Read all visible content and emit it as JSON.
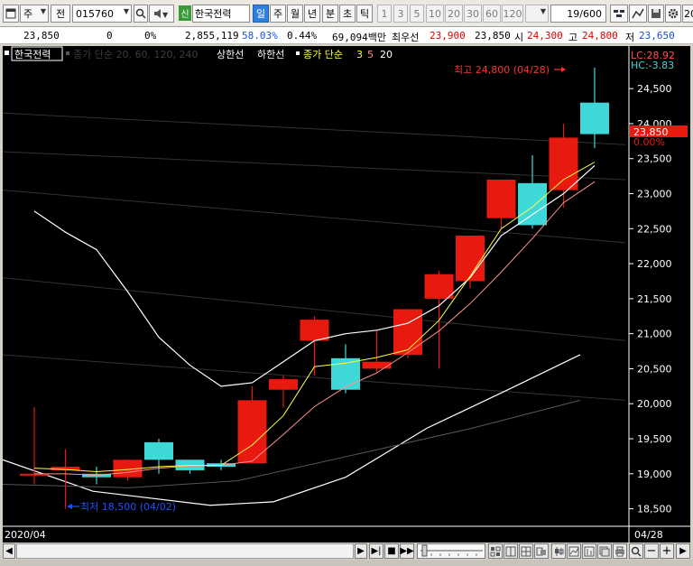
{
  "toolbar": {
    "market": "주",
    "type": "전",
    "code": "015760",
    "badge": "신",
    "name": "한국전력",
    "periods": [
      "일",
      "주",
      "월",
      "년",
      "분",
      "초",
      "틱"
    ],
    "active_period": "일",
    "intervals": [
      "1",
      "3",
      "5",
      "10",
      "20",
      "30",
      "60",
      "120"
    ],
    "page_counter": "19/600",
    "right_cut": "20"
  },
  "info": {
    "price": "23,850",
    "change": "0",
    "change_pct": "0%",
    "volume": "2,855,119",
    "vol_ratio": "58.03%",
    "turnover": "0.44%",
    "amount": "69,094백만",
    "best_ask_label": "최우선",
    "best_ask": "23,900",
    "best_bid": "23,850",
    "open_label": "시",
    "open": "24,300",
    "high_label": "고",
    "high": "24,800",
    "low_label": "저",
    "low": "23,650"
  },
  "legend": {
    "name": "한국전력",
    "ma_label": "종가 단순 20, 60, 120, 240",
    "upper_label": "상한선",
    "lower_label": "하한선",
    "ma2_label": "종가 단순",
    "ma2_values": [
      "3",
      "5",
      "20"
    ]
  },
  "annotations": {
    "high_text": "최고 24,800 (04/28)",
    "low_text": "최저 18,500 (04/02)",
    "lc_text": "LC:28.92",
    "hc_text": "HC:-3.83",
    "current_label": "23,850",
    "current_pct": "0.00%",
    "date_left": "2020/04",
    "date_right": "04/28"
  },
  "colors": {
    "up": "#e8190f",
    "down": "#3ed8d8",
    "ma3": "#ffff40",
    "ma5": "#ff9090",
    "ma20": "#ffffff",
    "axis_text": "#ffffff",
    "lc_hc": "#ff5050",
    "high_ann": "#ff3030",
    "low_ann": "#2050ff"
  },
  "chart_data": {
    "type": "candlestick",
    "y_ticks": [
      18500,
      19000,
      19500,
      20000,
      20500,
      21000,
      21500,
      22000,
      22500,
      23000,
      23500,
      24000,
      24500
    ],
    "ylim": [
      18250,
      24850
    ],
    "candles": [
      {
        "open": 19000,
        "high": 19950,
        "low": 18850,
        "close": 19000
      },
      {
        "open": 19050,
        "high": 19350,
        "low": 18500,
        "close": 19100
      },
      {
        "open": 19000,
        "high": 19100,
        "low": 18850,
        "close": 18950
      },
      {
        "open": 18950,
        "high": 19200,
        "low": 18900,
        "close": 19200
      },
      {
        "open": 19450,
        "high": 19500,
        "low": 19000,
        "close": 19200
      },
      {
        "open": 19200,
        "high": 19200,
        "low": 19000,
        "close": 19050
      },
      {
        "open": 19150,
        "high": 19200,
        "low": 19050,
        "close": 19100
      },
      {
        "open": 19150,
        "high": 20250,
        "low": 19150,
        "close": 20050
      },
      {
        "open": 20200,
        "high": 20400,
        "low": 19950,
        "close": 20350
      },
      {
        "open": 20900,
        "high": 21250,
        "low": 20400,
        "close": 21200
      },
      {
        "open": 20650,
        "high": 20850,
        "low": 20150,
        "close": 20200
      },
      {
        "open": 20500,
        "high": 21050,
        "low": 20450,
        "close": 20600
      },
      {
        "open": 20700,
        "high": 21350,
        "low": 20650,
        "close": 21350
      },
      {
        "open": 21500,
        "high": 21900,
        "low": 20500,
        "close": 21850
      },
      {
        "open": 21750,
        "high": 22400,
        "low": 21650,
        "close": 22400
      },
      {
        "open": 22650,
        "high": 23200,
        "low": 22500,
        "close": 23200
      },
      {
        "open": 23150,
        "high": 23550,
        "low": 22500,
        "close": 22550
      },
      {
        "open": 23050,
        "high": 24000,
        "low": 22800,
        "close": 23800
      },
      {
        "open": 24300,
        "high": 24800,
        "low": 23650,
        "close": 23850
      }
    ],
    "ma3": [
      19080,
      19060,
      19030,
      19060,
      19100,
      19120,
      19120,
      19410,
      19830,
      20530,
      20580,
      20660,
      20770,
      21190,
      21820,
      22500,
      22810,
      23200,
      23450
    ],
    "ma5": [
      19000,
      19000,
      18980,
      19020,
      19080,
      19110,
      19120,
      19180,
      19560,
      19960,
      20240,
      20440,
      20730,
      21040,
      21430,
      21880,
      22360,
      22870,
      23170
    ],
    "ma20": [
      22750,
      22450,
      22200,
      21600,
      20950,
      20550,
      20250,
      20300,
      20600,
      20900,
      21000,
      21050,
      21150,
      21400,
      21800,
      22400,
      22700,
      23000,
      23400
    ]
  },
  "scrollbar": {
    "buttons": [
      "◀",
      "▶",
      "▶|",
      "■",
      "▶▶"
    ],
    "zoom_out": "−",
    "zoom_in": "+",
    "end": "▶"
  }
}
